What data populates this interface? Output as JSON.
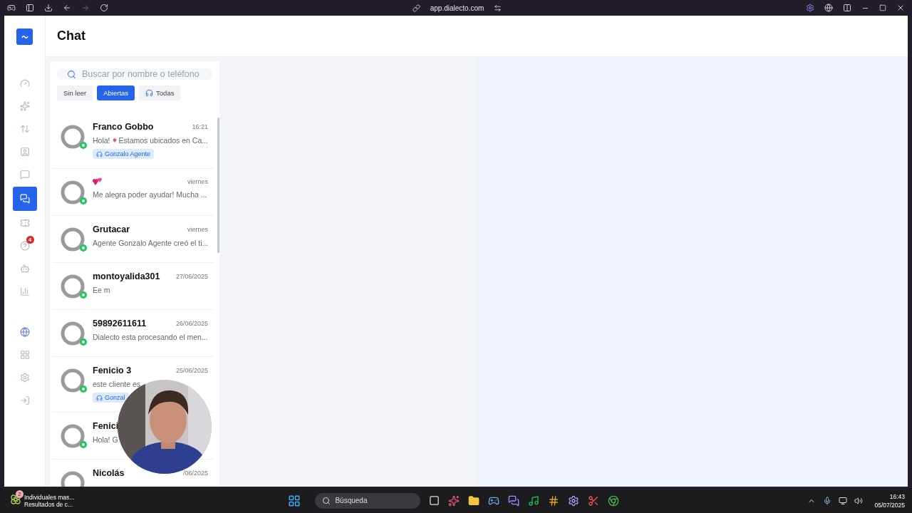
{
  "browser": {
    "url": "app.dialecto.com"
  },
  "sidebar": {
    "items": [
      {
        "selected": false
      },
      {
        "selected": false
      },
      {
        "selected": false
      },
      {
        "selected": false
      },
      {
        "selected": false
      },
      {
        "selected": true
      },
      {
        "selected": false
      },
      {
        "selected": false,
        "badge": "4"
      },
      {
        "selected": false
      },
      {
        "selected": false
      },
      {
        "selected": false
      },
      {
        "selected": false
      },
      {
        "selected": false
      },
      {
        "selected": false
      }
    ]
  },
  "header": {
    "title": "Chat"
  },
  "search": {
    "placeholder": "Buscar por nombre o teléfono"
  },
  "filters": [
    {
      "label": "Sin leer",
      "selected": false
    },
    {
      "label": "Abiertas",
      "selected": true
    },
    {
      "label": "Todas",
      "selected": false,
      "headset": true
    }
  ],
  "conversations": [
    {
      "kind": "text",
      "name": "Franco Gobbo",
      "time": "16:21",
      "preview": [
        {
          "text": "Hola!"
        },
        {
          "pin": true
        },
        {
          "text": "Estamos ubicados en Ca..."
        }
      ],
      "tag": "Gonzalo Agente"
    },
    {
      "kind": "emoji",
      "time": "viernes",
      "preview": [
        {
          "text": "Me alegra poder ayudar! Mucha ..."
        }
      ]
    },
    {
      "kind": "text",
      "name": "Grutacar",
      "time": "viernes",
      "preview": [
        {
          "text": "Agente Gonzalo Agente creó el ti..."
        }
      ]
    },
    {
      "kind": "text",
      "name": "montoyalida301",
      "time": "27/06/2025",
      "preview": [
        {
          "text": "Ee m"
        }
      ]
    },
    {
      "kind": "text",
      "name": "59892611611",
      "time": "26/06/2025",
      "preview": [
        {
          "text": "Dialecto esta procesando el men..."
        }
      ]
    },
    {
      "kind": "text",
      "name": "Fenicio 3",
      "time": "25/06/2025",
      "preview": [
        {
          "text": "este cliente es"
        }
      ],
      "tag": "Gonzal"
    },
    {
      "kind": "text",
      "name": "Fenici",
      "preview": [
        {
          "text": "Hola! G"
        }
      ]
    },
    {
      "kind": "text",
      "name": "Nicolás",
      "time": "/06/2025"
    }
  ],
  "taskbar": {
    "notification": {
      "badge": "2",
      "title": "Individuales mas...",
      "subtitle": "Resultados de c..."
    },
    "search": "Búsqueda",
    "time": "16:43",
    "date": "05/07/2025"
  }
}
